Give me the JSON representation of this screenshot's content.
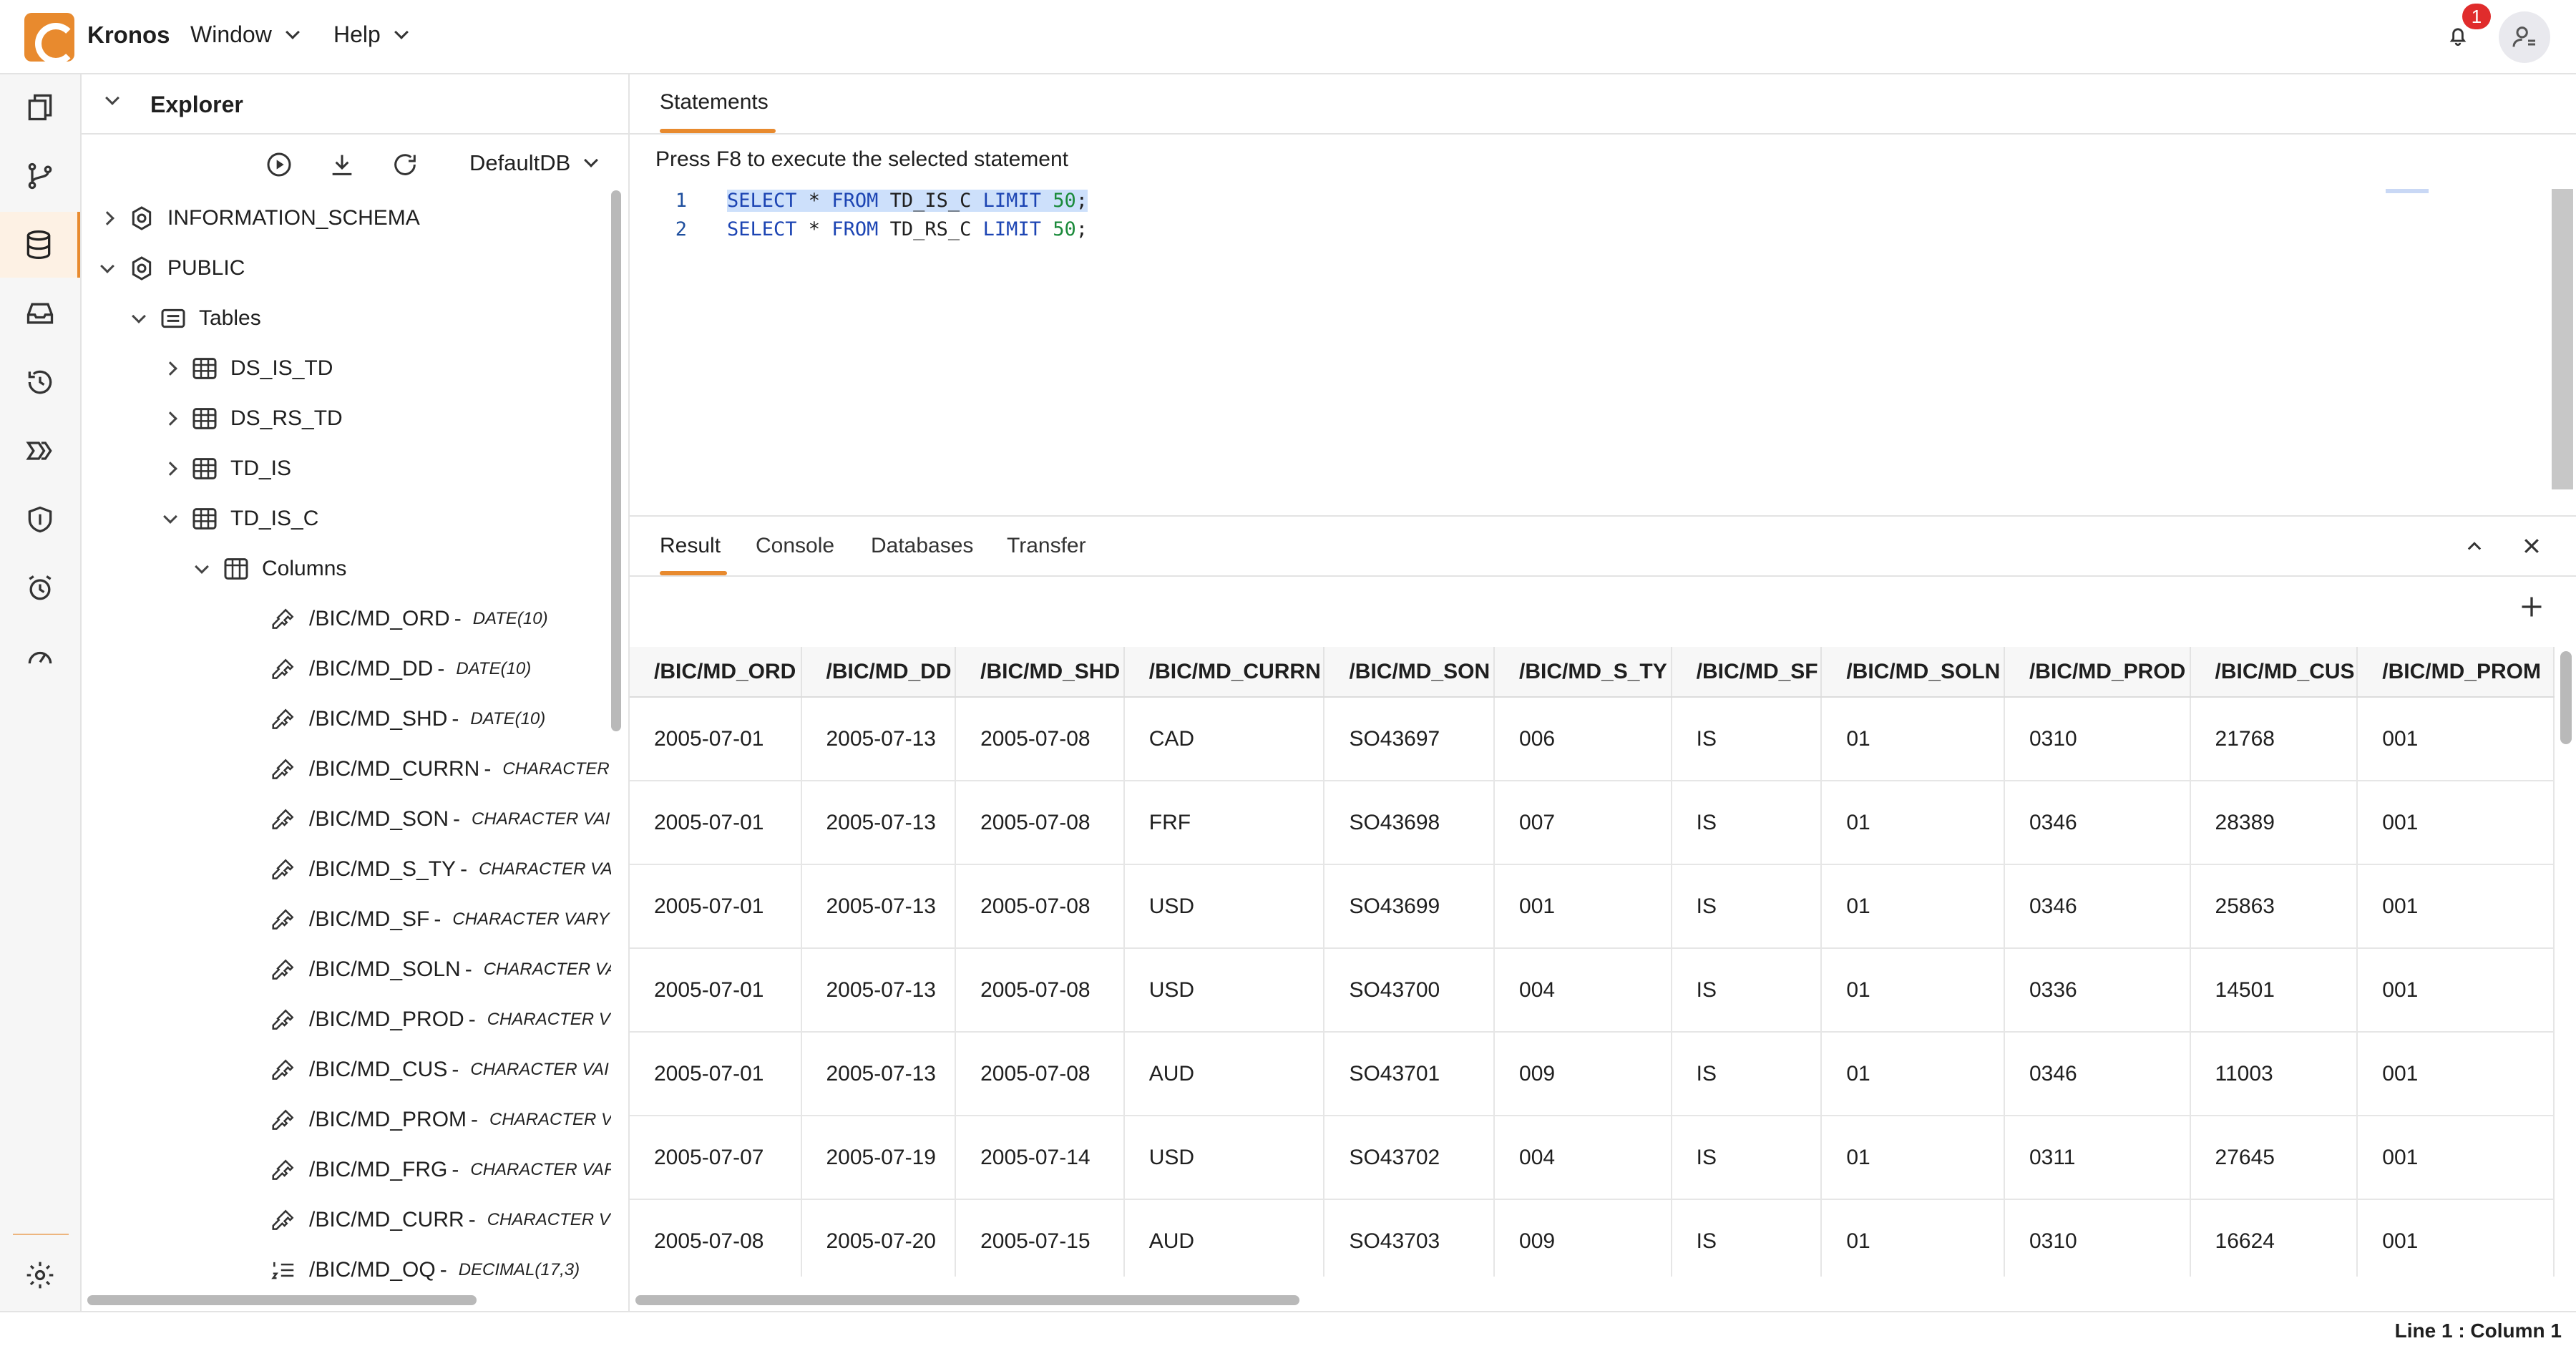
{
  "app": {
    "name": "Kronos",
    "notification_count": "1"
  },
  "menu": {
    "window": "Window",
    "help": "Help"
  },
  "explorer": {
    "title": "Explorer",
    "db_selected": "DefaultDB",
    "tree": [
      {
        "label": "INFORMATION_SCHEMA"
      },
      {
        "label": "PUBLIC"
      },
      {
        "label": "Tables"
      },
      {
        "label": "DS_IS_TD"
      },
      {
        "label": "DS_RS_TD"
      },
      {
        "label": "TD_IS"
      },
      {
        "label": "TD_IS_C"
      },
      {
        "label": "Columns"
      }
    ],
    "columns": [
      {
        "name": "/BIC/MD_ORD",
        "type": "DATE(10)"
      },
      {
        "name": "/BIC/MD_DD",
        "type": "DATE(10)"
      },
      {
        "name": "/BIC/MD_SHD",
        "type": "DATE(10)"
      },
      {
        "name": "/BIC/MD_CURRN",
        "type": "CHARACTER"
      },
      {
        "name": "/BIC/MD_SON",
        "type": "CHARACTER VAI"
      },
      {
        "name": "/BIC/MD_S_TY",
        "type": "CHARACTER VA"
      },
      {
        "name": "/BIC/MD_SF",
        "type": "CHARACTER VARY"
      },
      {
        "name": "/BIC/MD_SOLN",
        "type": "CHARACTER VA"
      },
      {
        "name": "/BIC/MD_PROD",
        "type": "CHARACTER V"
      },
      {
        "name": "/BIC/MD_CUS",
        "type": "CHARACTER VAI"
      },
      {
        "name": "/BIC/MD_PROM",
        "type": "CHARACTER V"
      },
      {
        "name": "/BIC/MD_FRG",
        "type": "CHARACTER VAF"
      },
      {
        "name": "/BIC/MD_CURR",
        "type": "CHARACTER V"
      },
      {
        "name": "/BIC/MD_OQ",
        "type": "DECIMAL(17,3)"
      }
    ]
  },
  "editor": {
    "tab": "Statements",
    "hint": "Press F8 to execute the selected statement",
    "lines": [
      {
        "no": "1",
        "kw1": "SELECT",
        "star": " * ",
        "kw2": "FROM",
        "table": " TD_IS_C ",
        "kw3": "LIMIT",
        "num": " 50",
        "end": ";"
      },
      {
        "no": "2",
        "kw1": "SELECT",
        "star": " * ",
        "kw2": "FROM",
        "table": " TD_RS_C ",
        "kw3": "LIMIT",
        "num": " 50",
        "end": ";"
      }
    ]
  },
  "result": {
    "tabs": [
      "Result",
      "Console",
      "Databases",
      "Transfer"
    ],
    "columns": [
      "/BIC/MD_ORD",
      "/BIC/MD_DD",
      "/BIC/MD_SHD",
      "/BIC/MD_CURRN",
      "/BIC/MD_SON",
      "/BIC/MD_S_TY",
      "/BIC/MD_SF",
      "/BIC/MD_SOLN",
      "/BIC/MD_PROD",
      "/BIC/MD_CUS",
      "/BIC/MD_PROM"
    ],
    "rows": [
      [
        "2005-07-01",
        "2005-07-13",
        "2005-07-08",
        "CAD",
        "SO43697",
        "006",
        "IS",
        "01",
        "0310",
        "21768",
        "001"
      ],
      [
        "2005-07-01",
        "2005-07-13",
        "2005-07-08",
        "FRF",
        "SO43698",
        "007",
        "IS",
        "01",
        "0346",
        "28389",
        "001"
      ],
      [
        "2005-07-01",
        "2005-07-13",
        "2005-07-08",
        "USD",
        "SO43699",
        "001",
        "IS",
        "01",
        "0346",
        "25863",
        "001"
      ],
      [
        "2005-07-01",
        "2005-07-13",
        "2005-07-08",
        "USD",
        "SO43700",
        "004",
        "IS",
        "01",
        "0336",
        "14501",
        "001"
      ],
      [
        "2005-07-01",
        "2005-07-13",
        "2005-07-08",
        "AUD",
        "SO43701",
        "009",
        "IS",
        "01",
        "0346",
        "11003",
        "001"
      ],
      [
        "2005-07-07",
        "2005-07-19",
        "2005-07-14",
        "USD",
        "SO43702",
        "004",
        "IS",
        "01",
        "0311",
        "27645",
        "001"
      ],
      [
        "2005-07-08",
        "2005-07-20",
        "2005-07-15",
        "AUD",
        "SO43703",
        "009",
        "IS",
        "01",
        "0310",
        "16624",
        "001"
      ]
    ]
  },
  "status": {
    "position": "Line 1 : Column 1"
  },
  "colors": {
    "accent": "#e88a2e",
    "badge": "#e02c2c",
    "keyword": "#1c44b3",
    "number": "#1a8a3a",
    "selection": "#cde0fb"
  }
}
